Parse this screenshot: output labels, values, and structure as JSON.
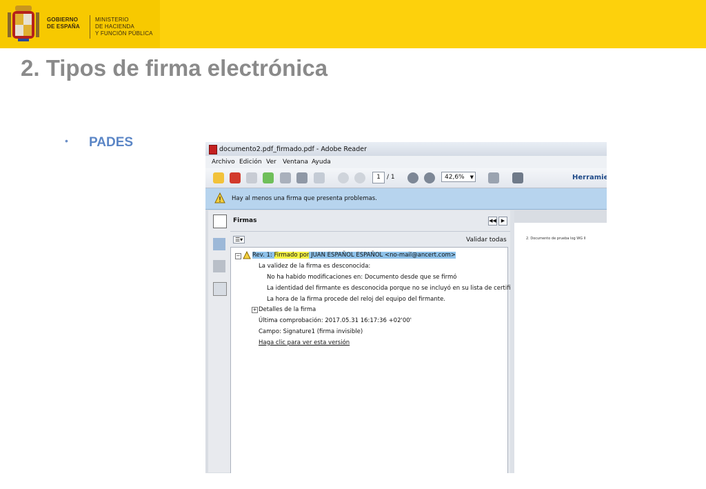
{
  "header": {
    "gobierno": [
      "GOBIERNO",
      "DE ESPAÑA"
    ],
    "ministerio": [
      "MINISTERIO",
      "DE HACIENDA",
      "Y FUNCIÓN PÚBLICA"
    ],
    "brand_color": "#FDD10C"
  },
  "slide": {
    "title": "2. Tipos de firma electrónica",
    "bullet_marker": "•",
    "bullet_text": "PADES"
  },
  "reader": {
    "window_title": "documento2.pdf_firmado.pdf - Adobe Reader",
    "menu": [
      "Archivo",
      "Edición",
      "Ver",
      "Ventana",
      "Ayuda"
    ],
    "page_current": "1",
    "page_total": "/ 1",
    "zoom": "42,6%",
    "tools_label": "Herramien",
    "warning": "Hay al menos una firma que presenta problemas.",
    "panel_title": "Firmas",
    "validate_all": "Validar todas",
    "tree": {
      "rev_prefix": "Rev. 1: ",
      "rev_signed": "Firmado por",
      "rev_name": " JUAN ESPAÑOL ESPAÑOL <no-mail@ancert.com>",
      "validity": "La validez de la firma es desconocida:",
      "d1": "No ha habido modificaciones en: Documento desde que se firmó",
      "d2": "La identidad del firmante es desconocida porque no se incluyó en su lista de certificados",
      "d3": "La hora de la firma procede del reloj del equipo del firmante.",
      "details": "Detalles de la firma",
      "last_check": "Última comprobación: 2017.05.31 16:17:36 +02'00'",
      "field": "Campo: Signature1 (firma invisible)",
      "view_version": "Haga clic para ver esta versión"
    },
    "doc_preview": "2. Documento de prueba log WG II"
  }
}
